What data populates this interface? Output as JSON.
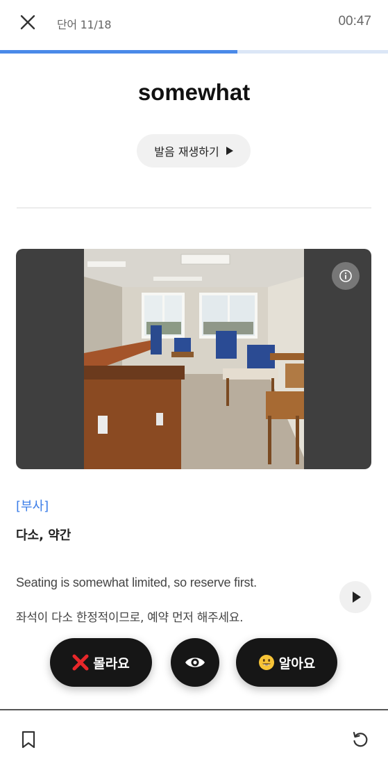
{
  "header": {
    "counter": "단어 11/18",
    "timer": "00:47",
    "close_icon": "close-icon",
    "progress_fraction": 0.611
  },
  "word": {
    "text": "somewhat",
    "pronunciation_label": "발음 재생하기",
    "play_icon": "play-icon"
  },
  "image": {
    "info_icon": "info-icon"
  },
  "definition": {
    "part_of_speech": "[부사]",
    "meaning": "다소, 약간"
  },
  "example": {
    "english": "Seating is somewhat limited, so reserve first.",
    "korean": "좌석이 다소 한정적이므로, 예약 먼저 해주세요.",
    "play_icon": "play-icon"
  },
  "actions": {
    "dont_know_label": "몰라요",
    "dont_know_icon": "cross-mark-icon",
    "reveal_icon": "eye-icon",
    "know_label": "알아요",
    "know_icon": "smiley-icon"
  },
  "footer": {
    "bookmark_icon": "bookmark-icon",
    "reset_icon": "refresh-icon"
  },
  "colors": {
    "accent": "#4a89e8",
    "button_dark": "#161616",
    "image_bg": "#3f3f3f",
    "cross_red": "#e8272a"
  }
}
